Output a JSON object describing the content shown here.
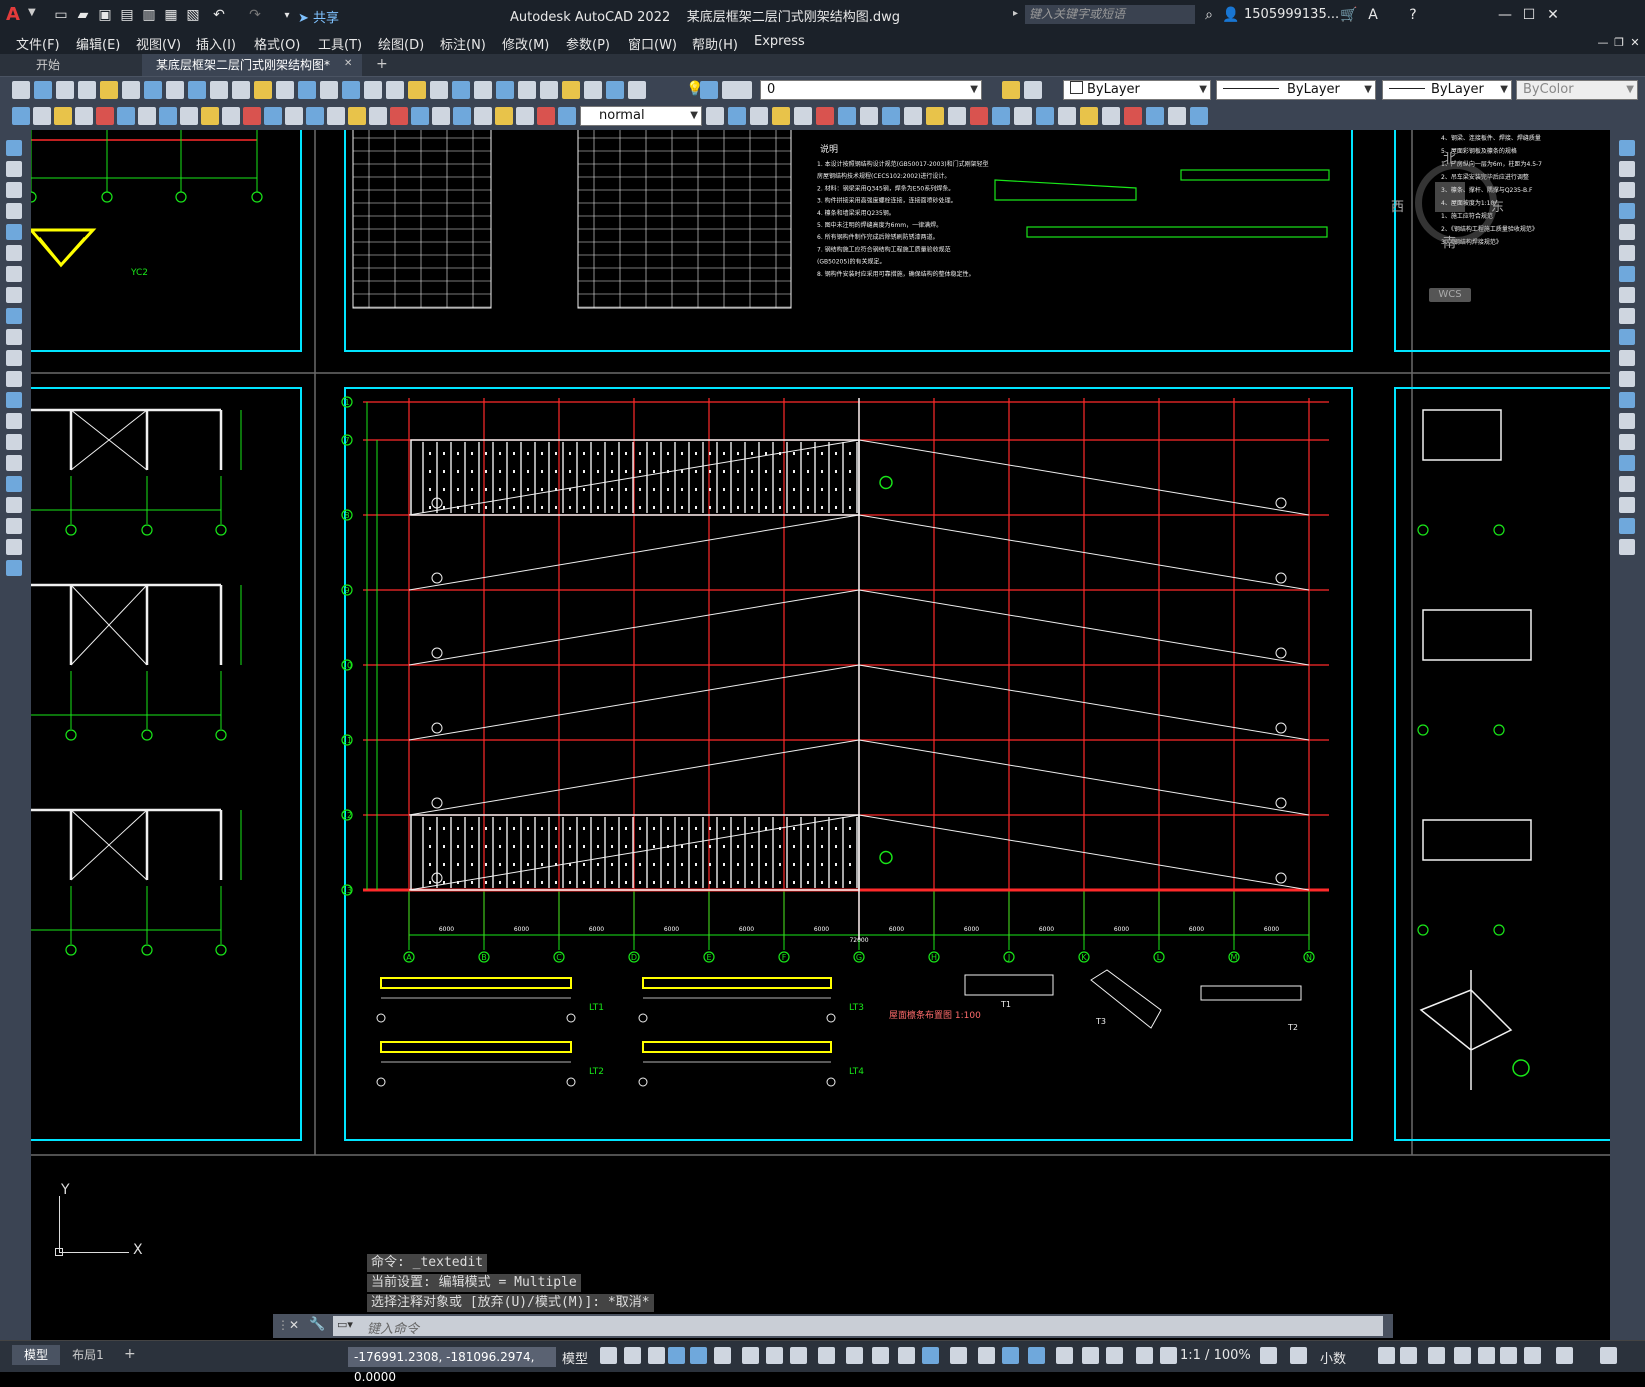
{
  "app": {
    "title": "Autodesk AutoCAD 2022    某底层框架二层门式刚架结构图.dwg",
    "share_label": "共享",
    "search_placeholder": "键入关键字或短语",
    "user": "1505999135...",
    "logo": "A"
  },
  "menu": [
    "文件(F)",
    "编辑(E)",
    "视图(V)",
    "插入(I)",
    "格式(O)",
    "工具(T)",
    "绘图(D)",
    "标注(N)",
    "修改(M)",
    "参数(P)",
    "窗口(W)",
    "帮助(H)",
    "Express"
  ],
  "tabs": {
    "start": "开始",
    "doc": "某底层框架二层门式刚架结构图*",
    "add": "+"
  },
  "toolbar": {
    "layer_value": "0",
    "color_value": "ByLayer",
    "linetype_value": "ByLayer",
    "lineweight_value": "ByLayer",
    "plotstyle_value": "ByColor",
    "textstyle_value": "normal"
  },
  "viewcube": {
    "north": "北",
    "south": "南",
    "west": "西",
    "east": "东",
    "wcs": "WCS"
  },
  "ucs": {
    "x": "X",
    "y": "Y"
  },
  "command": {
    "history": [
      "命令: _textedit",
      "当前设置: 编辑模式 = Multiple",
      "选择注释对象或 [放弃(U)/模式(M)]: *取消*"
    ],
    "placeholder": "键入命令"
  },
  "layout_tabs": {
    "model": "模型",
    "layout1": "布局1",
    "add": "+"
  },
  "status": {
    "coords": "-176991.2308, -181096.2974, 0.0000",
    "model": "模型",
    "scale": "1:1 / 100%",
    "units": "小数"
  },
  "drawing": {
    "axes_bottom": [
      "A",
      "B",
      "C",
      "D",
      "E",
      "F",
      "G",
      "H",
      "J",
      "K",
      "L",
      "M",
      "N"
    ],
    "axes_left": [
      "1",
      "7",
      "8",
      "9",
      "10",
      "11",
      "12",
      "13"
    ],
    "dim_bottom": "6000",
    "dim_total": "72000",
    "beam_labels": [
      "LT1",
      "LT2",
      "LT3",
      "LT4",
      "T1",
      "T2",
      "T3"
    ],
    "plan_title": "屋面檩条布置图 1:100",
    "detail_label": "YC2",
    "notes_title": "说明",
    "notes": [
      "1. 本设计按照钢结构设计规范(GB50017-2003)和门式刚架轻型",
      "房屋钢结构技术规程(CECS102:2002)进行设计。",
      "2. 材料：钢梁采用Q345钢，焊条为E50系列焊条。",
      "3. 构件拼接采用高强度螺栓连接，连接面喷砂处理。",
      "4. 檩条和墙梁采用Q235钢。",
      "5. 图中未注明的焊缝高度为6mm，一律满焊。",
      "6. 所有钢构件制作完成后除锈刷防锈漆两道。",
      "7. 钢结构施工应符合钢结构工程施工质量验收规范",
      "(GB50205)的有关规定。",
      "8. 钢构件安装时应采用可靠措施，确保结构的整体稳定性。"
    ],
    "right_notes": [
      "4、钢梁、连接板件、焊接、焊缝质量",
      "5、屋面彩钢板及檩条的规格",
      "1、厂房纵向一层为6m，柱距为4.5-7",
      "2、吊车梁安装完毕后应进行调整",
      "3、檩条、撑杆、隅撑与Q235-B.F",
      "4、屋面坡度为1:10",
      "1、施工应符合规范",
      "2、《钢结构工程施工质量验收规范》",
      "3、《钢结构焊接规范》"
    ]
  },
  "colors": {
    "canvas_bg": "#222733",
    "frame_cyan": "#00e5ff",
    "grid_red": "#ff2a2a",
    "dim_green": "#19e619",
    "line_white": "#f0f0f0",
    "yellow": "#ffff00"
  }
}
